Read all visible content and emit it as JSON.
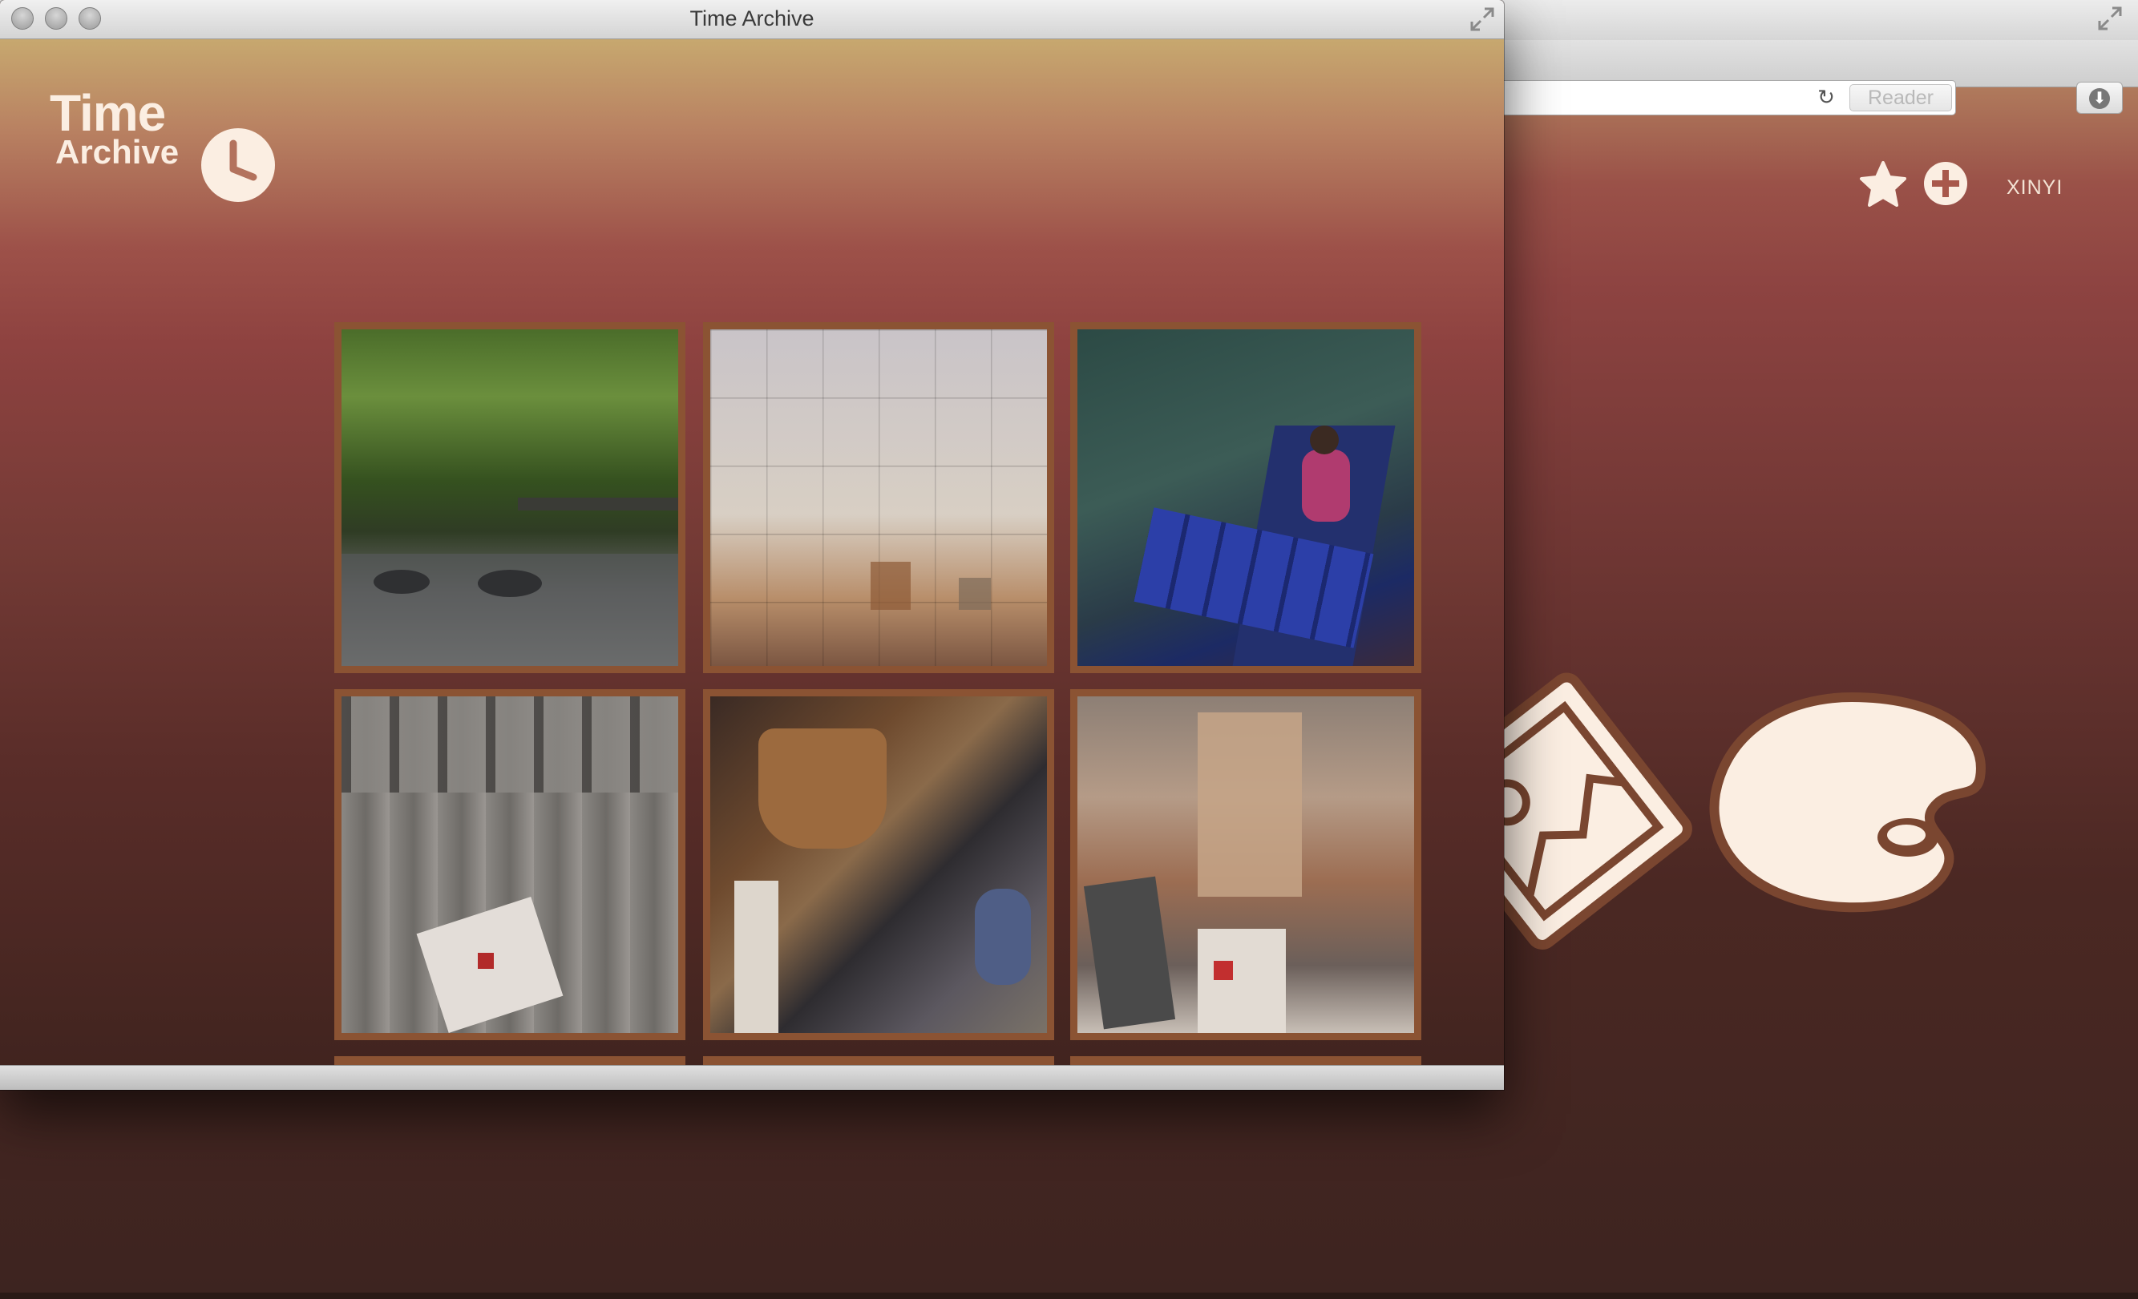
{
  "background_browser": {
    "reader_label": "Reader",
    "user_name": "XINYI",
    "icons": [
      "reload-icon",
      "download-icon",
      "star-icon",
      "plus-icon",
      "picture-icon",
      "palette-icon"
    ]
  },
  "app_window": {
    "title": "Time Archive",
    "logo": {
      "line1": "Time",
      "line2": "Archive",
      "icon": "clock-icon"
    },
    "photos": [
      {
        "name": "photo-garden-table"
      },
      {
        "name": "photo-lockers"
      },
      {
        "name": "photo-fishing-boat"
      },
      {
        "name": "photo-door-mailbox"
      },
      {
        "name": "photo-basket-alley"
      },
      {
        "name": "photo-rusty-mailboxes"
      }
    ]
  },
  "colors": {
    "gradient_top": "#c7a86f",
    "gradient_mid": "#8e4240",
    "gradient_bottom": "#41241f",
    "tile_border": "#8b5333",
    "icon_fill": "#fbeee2"
  }
}
